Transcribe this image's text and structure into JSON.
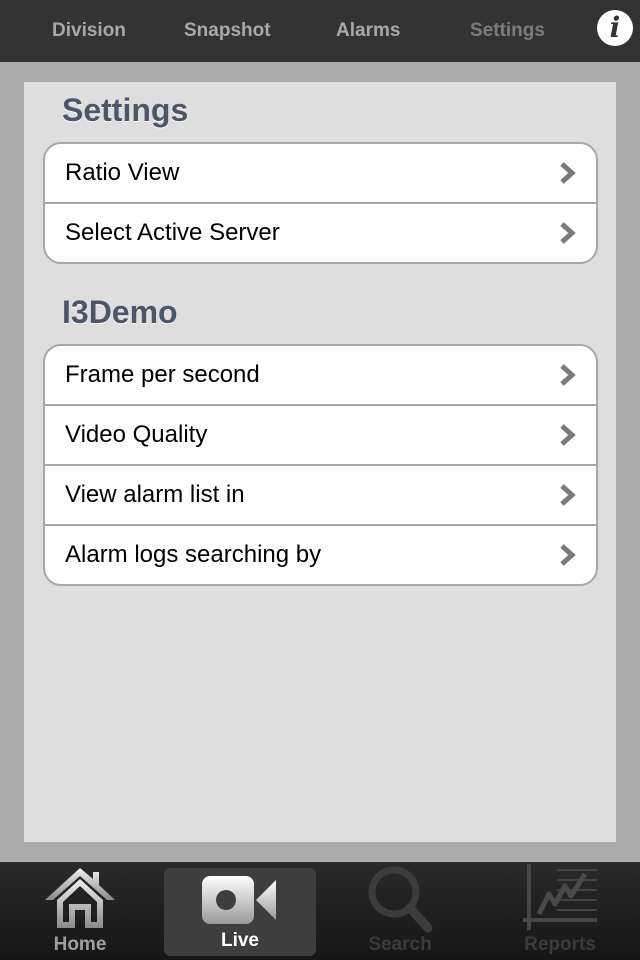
{
  "top_nav": {
    "tabs": [
      {
        "label": "Division",
        "active": false
      },
      {
        "label": "Snapshot",
        "active": false
      },
      {
        "label": "Alarms",
        "active": false
      },
      {
        "label": "Settings",
        "active": true
      }
    ],
    "info_icon": "info-icon",
    "info_glyph": "i"
  },
  "sections": [
    {
      "title": "Settings",
      "rows": [
        {
          "label": "Ratio View",
          "icon": "chevron-right-icon"
        },
        {
          "label": "Select Active Server",
          "icon": "chevron-right-icon"
        }
      ]
    },
    {
      "title": "I3Demo",
      "rows": [
        {
          "label": "Frame per second",
          "icon": "chevron-right-icon"
        },
        {
          "label": "Video Quality",
          "icon": "chevron-right-icon"
        },
        {
          "label": "View alarm list in",
          "icon": "chevron-right-icon"
        },
        {
          "label": "Alarm logs searching by",
          "icon": "chevron-right-icon"
        }
      ]
    }
  ],
  "tab_bar": {
    "items": [
      {
        "label": "Home",
        "icon": "home-icon",
        "state": "enabled"
      },
      {
        "label": "Live",
        "icon": "video-camera-icon",
        "state": "selected"
      },
      {
        "label": "Search",
        "icon": "magnifier-icon",
        "state": "disabled"
      },
      {
        "label": "Reports",
        "icon": "line-chart-icon",
        "state": "disabled"
      }
    ]
  },
  "colors": {
    "top_bar": "#333333",
    "background": "#acacac",
    "panel": "#dedede",
    "section_title": "#4c566a",
    "chevron": "#7a7a7a"
  }
}
